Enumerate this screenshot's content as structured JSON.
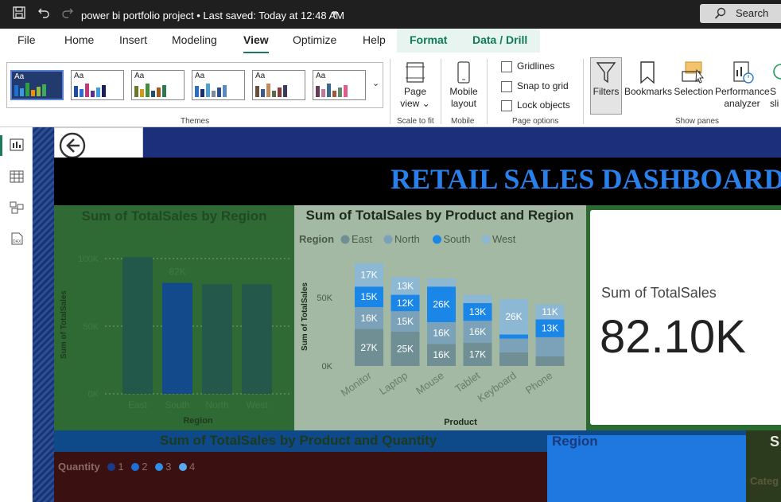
{
  "titlebar": {
    "title": "power bi portfolio project • Last saved: Today at 12:48 AM",
    "search_label": "Search"
  },
  "menu": {
    "tabs": [
      "File",
      "Home",
      "Insert",
      "Modeling",
      "View",
      "Optimize",
      "Help"
    ],
    "active_tab": "View",
    "context_tabs": [
      "Format",
      "Data / Drill"
    ]
  },
  "ribbon": {
    "groups": {
      "themes": "Themes",
      "scale": "Scale to fit",
      "mobile": "Mobile",
      "page_options": "Page options",
      "show_panes": "Show panes"
    },
    "theme_label": "Aa",
    "page_view": [
      "Page",
      "view ⌄"
    ],
    "mobile_layout": [
      "Mobile",
      "layout"
    ],
    "checkboxes": [
      "Gridlines",
      "Snap to grid",
      "Lock objects"
    ],
    "filters": "Filters",
    "bookmarks": "Bookmarks",
    "selection": "Selection",
    "performance": [
      "Performance",
      "analyzer"
    ],
    "partial": [
      "S",
      "sli"
    ]
  },
  "theme_colors": [
    [
      "#1d6fd0",
      "#3a9bdc",
      "#2f9e44",
      "#f08c00",
      "#8fbf3c",
      "#3faa5a"
    ],
    [
      "#1a4fa0",
      "#2b6fd6",
      "#c0397a",
      "#5a2e8a",
      "#3c9cdc",
      "#1e1e5a"
    ],
    [
      "#6a7a2a",
      "#d09a1a",
      "#3f8f3f",
      "#1e4e6e",
      "#a05a1a",
      "#2e7a4e"
    ],
    [
      "#2d6fbf",
      "#1a2e6e",
      "#4fa0d0",
      "#7a8a9a",
      "#2b4e8a",
      "#5a8ac0"
    ],
    [
      "#6a4e3a",
      "#3a5a8a",
      "#c08a5a",
      "#5a6a4a",
      "#8a3a3a",
      "#3a3a5a"
    ],
    [
      "#6a3a5a",
      "#c07a9a",
      "#3a6a8a",
      "#9a5a3a",
      "#5a8a6a",
      "#e05a8a"
    ]
  ],
  "dashboard": {
    "title": "RETAIL SALES DASHBOARD",
    "card": {
      "label": "Sum of TotalSales",
      "value": "82.10K"
    },
    "qty_title": "Sum of TotalSales by Product and Quantity",
    "qty_legend_title": "Quantity",
    "qty_legend": [
      "1",
      "2",
      "3",
      "4"
    ],
    "qty_colors": [
      "#1a3a8a",
      "#1e6fd6",
      "#2f8ee6",
      "#5aa8ee"
    ],
    "region_filter_title": "Region",
    "cat_title": "S",
    "cat_sub": "Categ"
  },
  "chart_data": [
    {
      "type": "bar",
      "title": "Sum of TotalSales by Region",
      "xlabel": "Region",
      "ylabel": "Sum of TotalSales",
      "categories": [
        "East",
        "South",
        "North",
        "West"
      ],
      "values": [
        101,
        82,
        81,
        81
      ],
      "data_labels": [
        "",
        "82K",
        "",
        ""
      ],
      "yticks": [
        "0K",
        "50K",
        "100K"
      ],
      "ylim": [
        0,
        100
      ],
      "colors": [
        "#21584a",
        "#134a8c",
        "#23584a",
        "#23584a"
      ],
      "grid": true
    },
    {
      "type": "bar",
      "stacked": true,
      "title": "Sum of TotalSales by Product and Region",
      "xlabel": "Product",
      "ylabel": "Sum of TotalSales",
      "legend_title": "Region",
      "legend_position": "top-left",
      "categories": [
        "Monitor",
        "Laptop",
        "Mouse",
        "Tablet",
        "Keyboard",
        "Phone"
      ],
      "yticks": [
        "0K",
        "50K"
      ],
      "ylim": [
        0,
        100
      ],
      "series": [
        {
          "name": "East",
          "color": "#6f8f95",
          "values": [
            27,
            25,
            16,
            17,
            10,
            7
          ],
          "labels": [
            "27K",
            "25K",
            "16K",
            "17K",
            "",
            ""
          ]
        },
        {
          "name": "North",
          "color": "#7ba2b8",
          "values": [
            16,
            15,
            16,
            16,
            10,
            14
          ],
          "labels": [
            "16K",
            "15K",
            "16K",
            "16K",
            "",
            ""
          ]
        },
        {
          "name": "South",
          "color": "#1a86e8",
          "values": [
            15,
            12,
            26,
            13,
            3,
            13
          ],
          "labels": [
            "15K",
            "12K",
            "26K",
            "13K",
            "",
            "13K"
          ]
        },
        {
          "name": "West",
          "color": "#8db8d4",
          "values": [
            17,
            13,
            6,
            6,
            26,
            11
          ],
          "labels": [
            "17K",
            "13K",
            "",
            "",
            "26K",
            "11K"
          ]
        }
      ]
    }
  ]
}
